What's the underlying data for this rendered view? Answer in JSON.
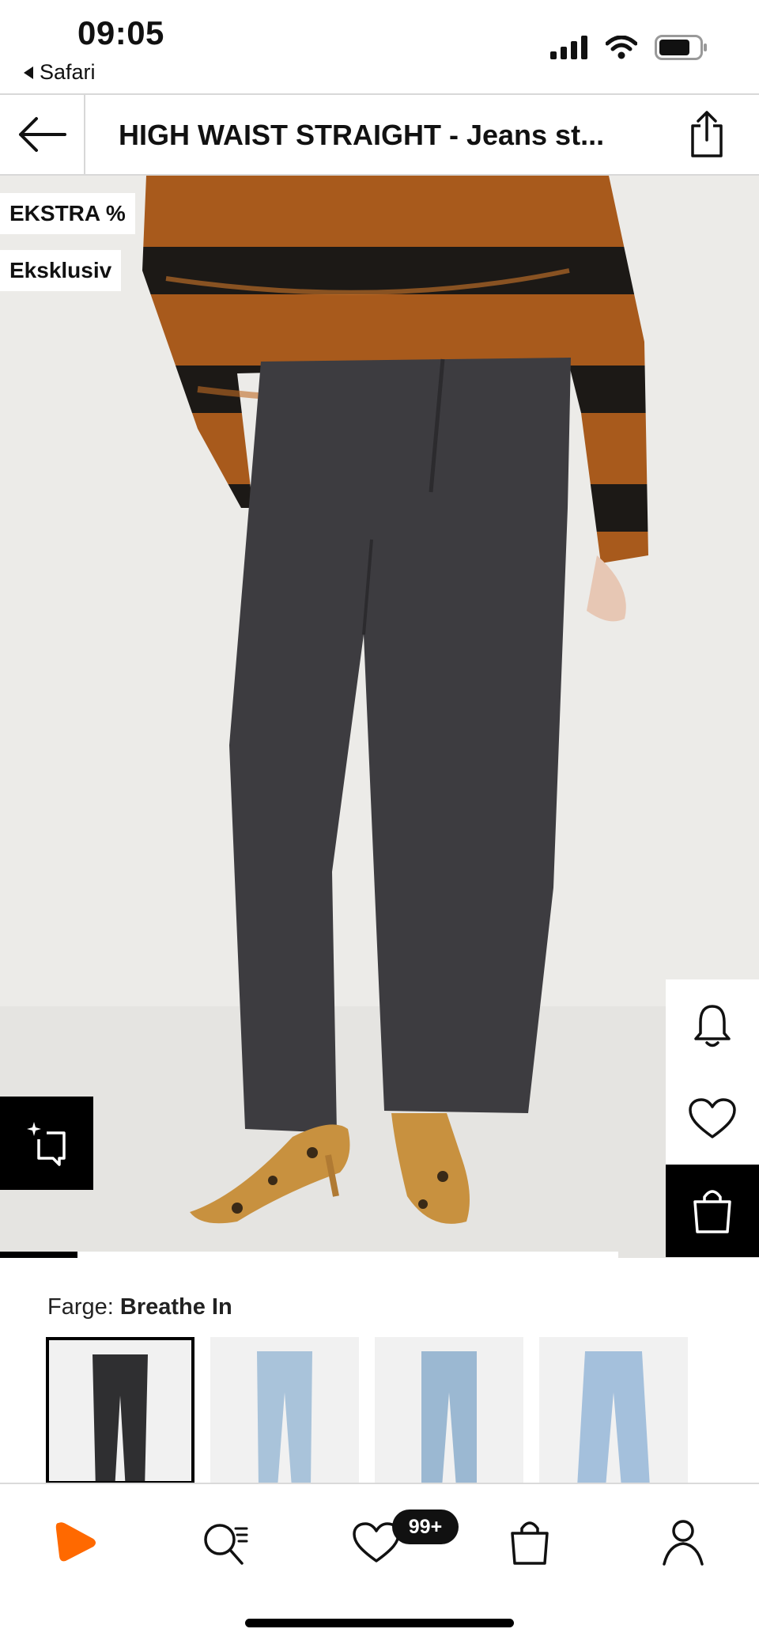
{
  "status_bar": {
    "time": "09:05",
    "back_app": "Safari",
    "icons": [
      "signal-icon",
      "wifi-icon",
      "battery-icon"
    ]
  },
  "nav": {
    "title": "HIGH WAIST STRAIGHT - Jeans st...",
    "back_icon": "arrow-left-icon",
    "share_icon": "share-icon"
  },
  "product": {
    "badges": [
      "EKSTRA %",
      "Eksklusiv"
    ],
    "image_count_progress": 0.125,
    "side_actions": [
      "bell-icon",
      "heart-icon",
      "shopping-bag-icon"
    ],
    "similar_icon": "sparkle-crop-icon"
  },
  "color": {
    "label": "Farge:",
    "selected_name": "Breathe In",
    "swatches": [
      {
        "name": "dark-grey-jeans",
        "hex": "#2f2f31"
      },
      {
        "name": "light-blue-jeans-1",
        "hex": "#a9c3da"
      },
      {
        "name": "light-blue-jeans-2",
        "hex": "#9bb8d2"
      },
      {
        "name": "light-blue-jeans-3",
        "hex": "#a4c0dc"
      }
    ]
  },
  "tabbar": {
    "items": [
      "home-icon",
      "search-icon",
      "wishlist-icon",
      "bag-icon",
      "profile-icon"
    ],
    "wishlist_count": "99+",
    "brand_color": "#ff6900"
  }
}
